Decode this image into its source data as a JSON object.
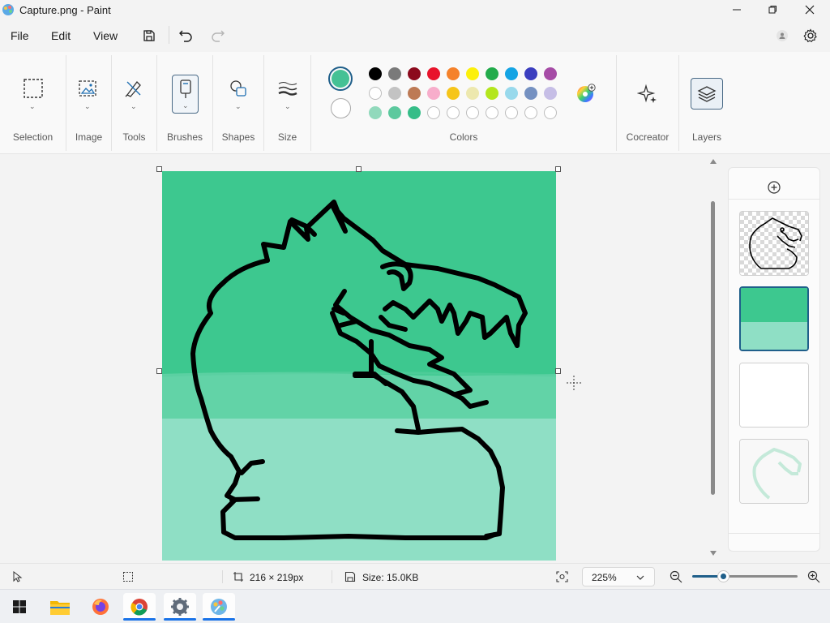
{
  "window": {
    "title": "Capture.png - Paint"
  },
  "menu": {
    "file": "File",
    "edit": "Edit",
    "view": "View"
  },
  "ribbon": {
    "groups": {
      "selection": "Selection",
      "image": "Image",
      "tools": "Tools",
      "brushes": "Brushes",
      "shapes": "Shapes",
      "size": "Size",
      "colors": "Colors",
      "cocreator": "Cocreator",
      "layers": "Layers"
    },
    "primary_color": "#45c195",
    "secondary_color": "#ffffff",
    "palette": [
      [
        "#000000",
        "#7a7a7a",
        "#8c0a1d",
        "#e8132b",
        "#f5822b",
        "#fcf00a",
        "#22ab4b",
        "#14a4e4",
        "#3b3ebf",
        "#a64ca6"
      ],
      [
        "#ffffff",
        "#c3c3c3",
        "#bd7a55",
        "#f7adcb",
        "#f6c51a",
        "#ede8ae",
        "#b4e61d",
        "#98d9ec",
        "#7591c1",
        "#c6bee6"
      ],
      [
        "#91d9bc",
        "#5cc99e",
        "#35bd88",
        "",
        "",
        "",
        "",
        "",
        "",
        ""
      ]
    ]
  },
  "canvas": {
    "background_top": "#3dc88f",
    "background_bottom": "#8fdfc5"
  },
  "status": {
    "dimensions": "216 × 219px",
    "size": "Size: 15.0KB",
    "zoom": "225%"
  },
  "taskbar": {
    "apps": [
      "start",
      "file-explorer",
      "firefox",
      "chrome",
      "settings",
      "paint"
    ]
  }
}
